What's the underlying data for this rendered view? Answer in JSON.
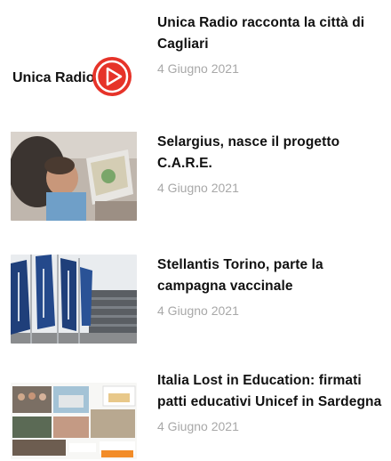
{
  "articles": [
    {
      "title": "Unica Radio racconta la città di Cagliari",
      "date": "4 Giugno 2021",
      "thumbnail": {
        "alt": "Unica Radio logo",
        "logo_text": "Unica Radio",
        "accent": "#e63329"
      }
    },
    {
      "title": "Selargius, nasce il progetto C.A.R.E.",
      "date": "4 Giugno 2021",
      "thumbnail": {
        "alt": "Child reading a book with adult"
      }
    },
    {
      "title": "Stellantis Torino, parte la campagna vaccinale",
      "date": "4 Giugno 2021",
      "thumbnail": {
        "alt": "Stellantis flags in front of building"
      }
    },
    {
      "title": "Italia Lost in Education: firmati patti educativi Unicef in Sardegna",
      "date": "4 Giugno 2021",
      "thumbnail": {
        "alt": "Collage of group photos"
      }
    }
  ]
}
